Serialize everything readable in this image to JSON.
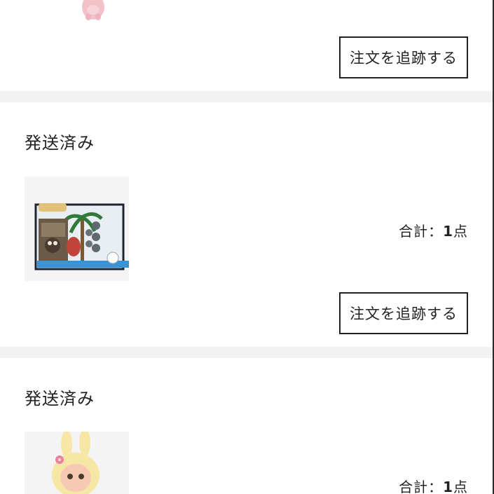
{
  "orders": [
    {
      "status": "",
      "total_label": "",
      "total_count": "",
      "total_unit": "",
      "track_button": "注文を追跡する",
      "product_image": "pink-plush-figure"
    },
    {
      "status": "発送済み",
      "total_label": "合計：",
      "total_count": "1",
      "total_unit": "点",
      "track_button": "注文を追跡する",
      "product_image": "diorama-box-figure"
    },
    {
      "status": "発送済み",
      "total_label": "合計：",
      "total_count": "1",
      "total_unit": "点",
      "track_button": "",
      "product_image": "bunny-hood-figure"
    }
  ],
  "colors": {
    "divider": "#f2f2f2",
    "thumb_bg": "#f4f4f4",
    "text": "#222222",
    "button_border": "#222222"
  }
}
